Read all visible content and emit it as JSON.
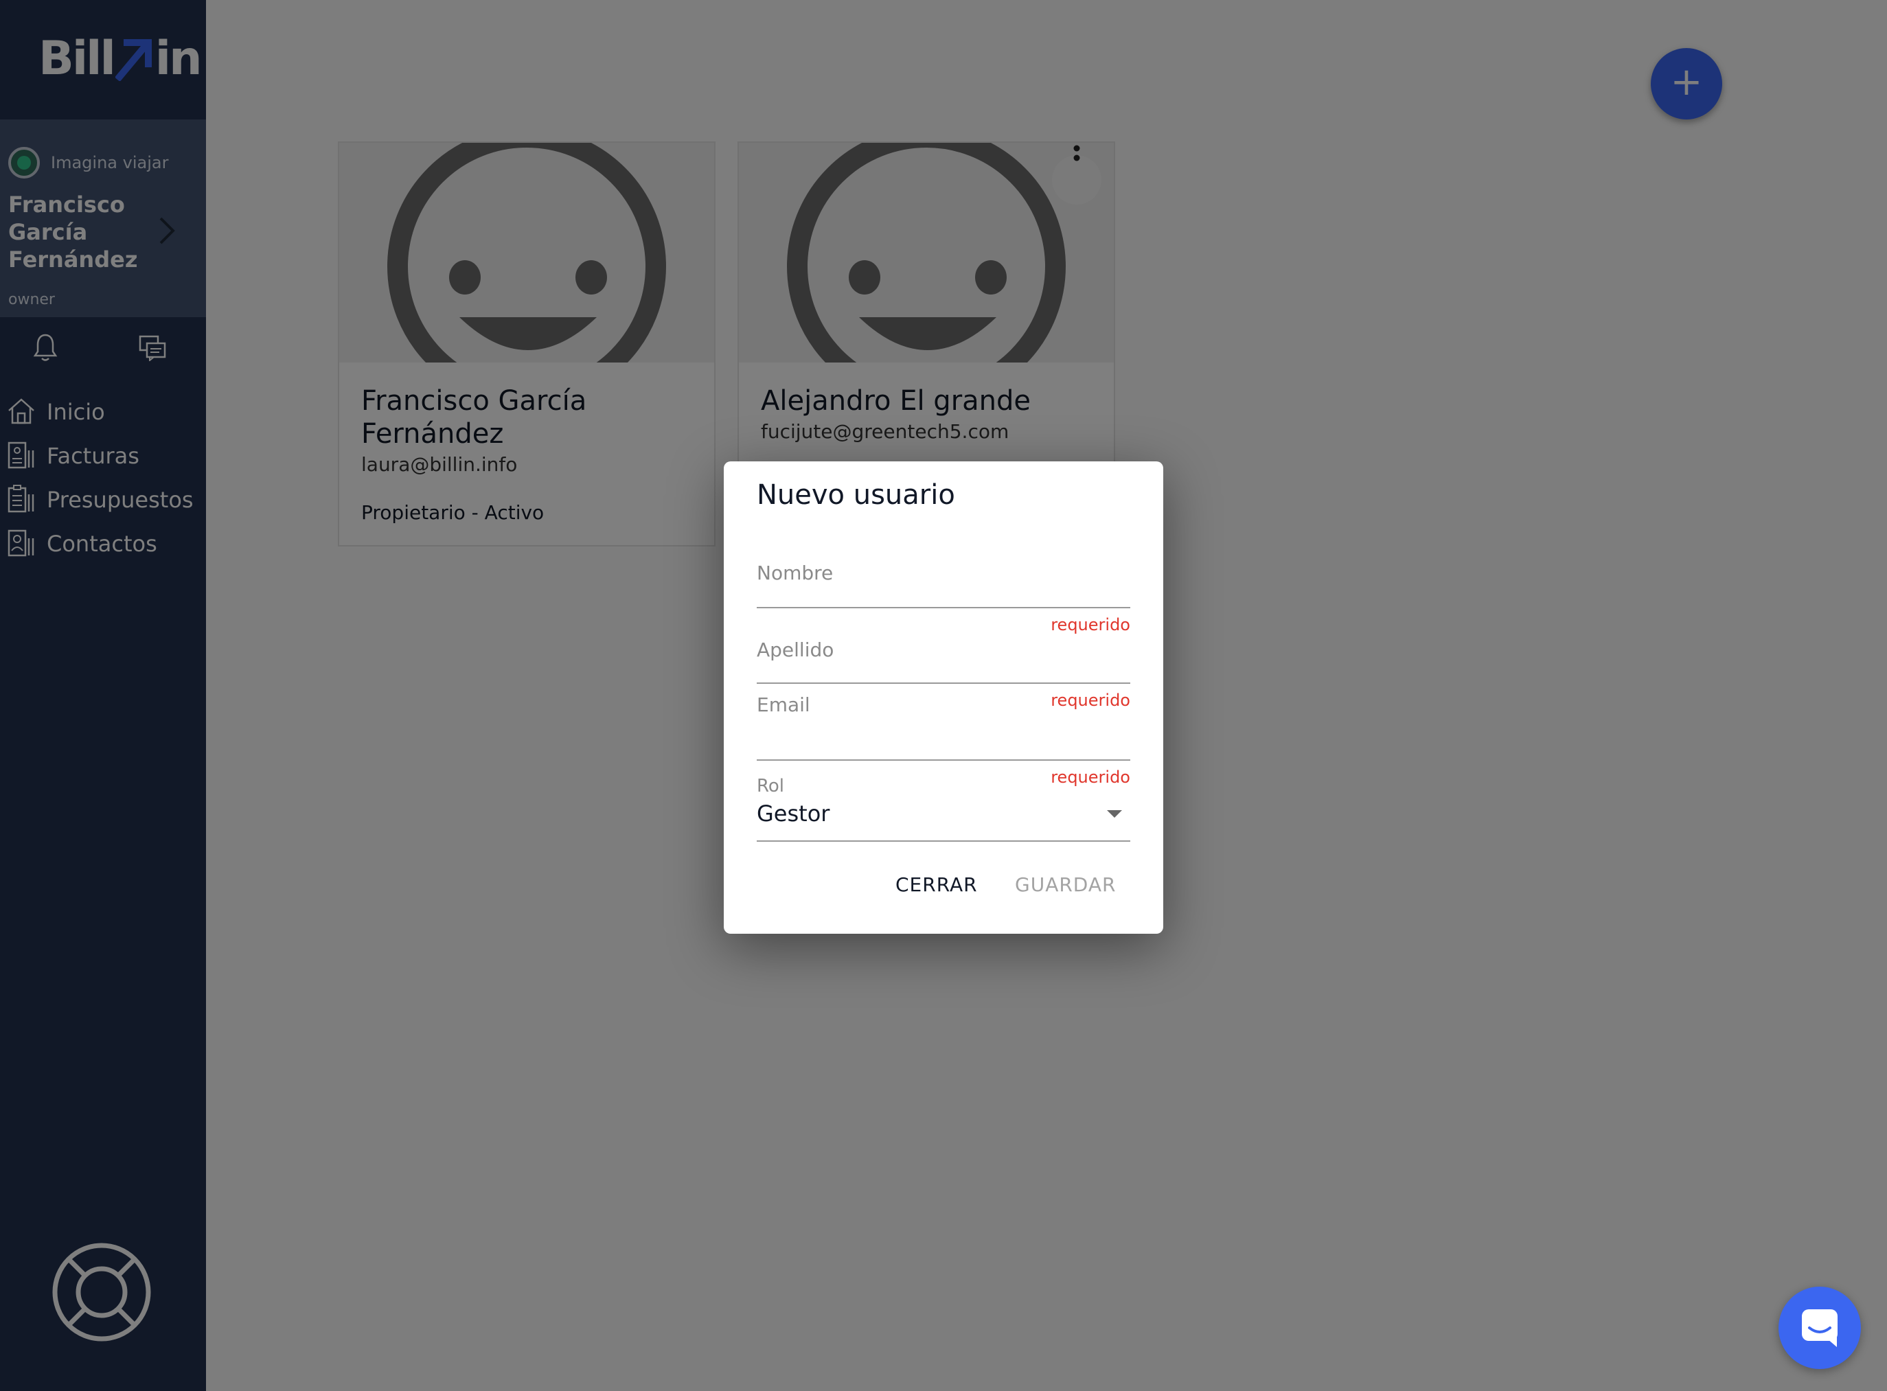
{
  "brand": {
    "logo_left": "Bill",
    "logo_right": "in",
    "accent": "#3b66f0"
  },
  "account": {
    "company": "Imagina viajar",
    "user_name": "Francisco García Fernández",
    "role": "owner"
  },
  "nav": {
    "items": [
      {
        "label": "Inicio",
        "icon": "home-icon"
      },
      {
        "label": "Facturas",
        "icon": "invoice-icon"
      },
      {
        "label": "Presupuestos",
        "icon": "quote-icon"
      },
      {
        "label": "Contactos",
        "icon": "contacts-icon"
      }
    ]
  },
  "cards": [
    {
      "name": "Francisco García Fernández",
      "email": "laura@billin.info",
      "status": "Propietario - Activo"
    },
    {
      "name": "Alejandro El grande",
      "email": "fucijute@greentech5.com"
    }
  ],
  "fab": {
    "label": "+"
  },
  "dialog": {
    "title": "Nuevo usuario",
    "fields": [
      {
        "label": "Nombre",
        "hint": "requerido"
      },
      {
        "label": "Apellido",
        "hint": "requerido"
      },
      {
        "label": "Email",
        "hint": "requerido"
      }
    ],
    "role": {
      "label": "Rol",
      "value": "Gestor"
    },
    "close_label": "CERRAR",
    "save_label": "GUARDAR"
  }
}
